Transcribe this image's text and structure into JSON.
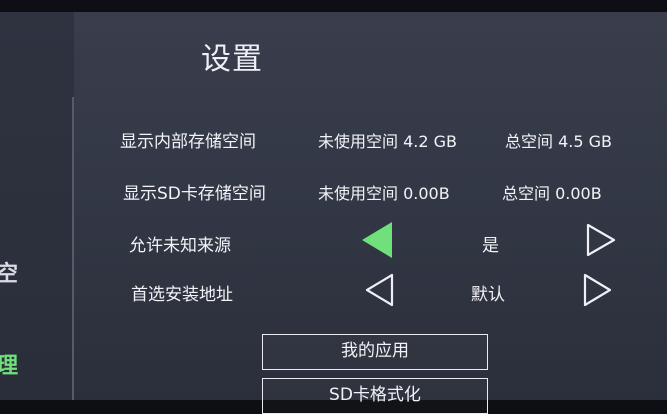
{
  "left_fragments": {
    "a": "空",
    "b": "理"
  },
  "title": "设置",
  "rows": [
    {
      "label": "显示内部存储空间",
      "unused": "未使用空间 4.2 GB",
      "total": "总空间 4.5 GB"
    },
    {
      "label": "显示SD卡存储空间",
      "unused": "未使用空间 0.00B",
      "total": "总空间 0.00B"
    },
    {
      "label": "允许未知来源",
      "value": "是"
    },
    {
      "label": "首选安装地址",
      "value": "默认"
    }
  ],
  "buttons": {
    "my_apps": "我的应用",
    "sd_format": "SD卡格式化"
  },
  "colors": {
    "accent": "#6fe07a",
    "screen_bg": "#353a47"
  },
  "icons": {
    "left": "left-triangle-icon",
    "right": "right-triangle-icon"
  }
}
